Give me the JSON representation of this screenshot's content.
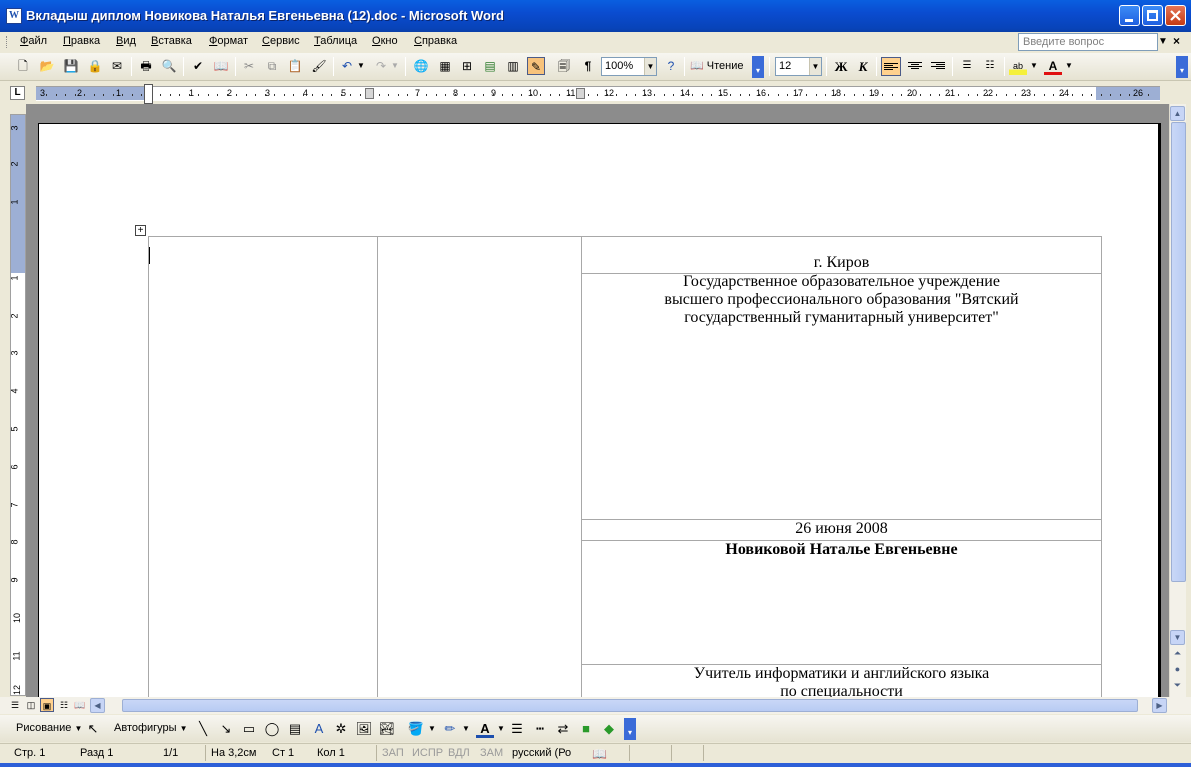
{
  "window": {
    "title": "Вкладыш диплом Новикова Наталья Евгеньевна (12).doc - Microsoft Word"
  },
  "menu": {
    "items": [
      "Файл",
      "Правка",
      "Вид",
      "Вставка",
      "Формат",
      "Сервис",
      "Таблица",
      "Окно",
      "Справка"
    ],
    "ask_placeholder": "Введите вопрос"
  },
  "toolbar": {
    "zoom": "100%",
    "read_label": "Чтение",
    "font_size": "12",
    "bold_label": "Ж",
    "italic_label": "К"
  },
  "ruler": {
    "h_numbers": [
      "3",
      "2",
      "1",
      "1",
      "2",
      "3",
      "4",
      "5",
      "7",
      "8",
      "9",
      "10",
      "11",
      "12",
      "13",
      "14",
      "15",
      "16",
      "17",
      "18",
      "19",
      "20",
      "21",
      "22",
      "23",
      "24",
      "26"
    ],
    "v_numbers": [
      "3",
      "2",
      "1",
      "1",
      "2",
      "3",
      "4",
      "5",
      "6",
      "7",
      "8",
      "9",
      "10",
      "11",
      "12"
    ]
  },
  "document": {
    "city": "г. Киров",
    "institution": [
      "Государственное образовательное учреждение",
      "высшего профессионального образования \"Вятский",
      "государственный гуманитарный университет\""
    ],
    "date": "26 июня 2008",
    "recipient": "Новиковой Наталье Евгеньевне",
    "qualification": [
      "Учитель информатики и английского языка",
      "по специальности"
    ]
  },
  "drawing_toolbar": {
    "draw_label": "Рисование",
    "autoshapes_label": "Автофигуры"
  },
  "status": {
    "page": "Стр. 1",
    "section": "Разд 1",
    "pages": "1/1",
    "at": "На 3,2см",
    "line": "Ст 1",
    "col": "Кол 1",
    "rec": "ЗАП",
    "trk": "ИСПР",
    "ext": "ВДЛ",
    "ovr": "ЗАМ",
    "lang": "русский (Ро"
  }
}
